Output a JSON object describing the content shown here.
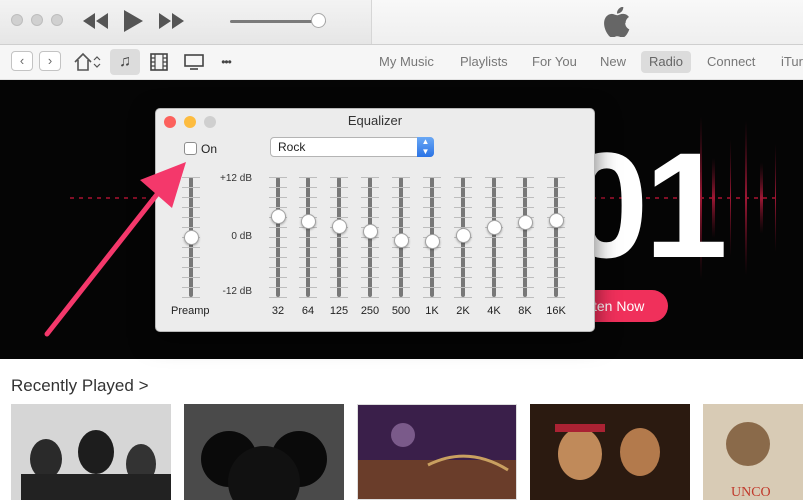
{
  "toolbar": {
    "volume": 0.92
  },
  "nav": {
    "back": "‹",
    "forward": "›",
    "more": "•••",
    "links": [
      {
        "label": "My Music",
        "selected": false
      },
      {
        "label": "Playlists",
        "selected": false
      },
      {
        "label": "For You",
        "selected": false
      },
      {
        "label": "New",
        "selected": false
      },
      {
        "label": "Radio",
        "selected": true
      },
      {
        "label": "Connect",
        "selected": false
      },
      {
        "label": "iTur",
        "selected": false
      }
    ]
  },
  "hero": {
    "big_text": "01",
    "button": "ten Now",
    "accent": "#f0305b"
  },
  "recent": {
    "title": "Recently Played >"
  },
  "equalizer": {
    "title": "Equalizer",
    "on_label": "On",
    "on_checked": false,
    "preset": "Rock",
    "db_top": "+12 dB",
    "db_mid": "0 dB",
    "db_bot": "-12 dB",
    "preamp_label": "Preamp",
    "preamp_db": 0,
    "bands": [
      {
        "freq": "32",
        "db": 4.2
      },
      {
        "freq": "64",
        "db": 3.2
      },
      {
        "freq": "125",
        "db": 2.3
      },
      {
        "freq": "250",
        "db": 1.2
      },
      {
        "freq": "500",
        "db": -0.5
      },
      {
        "freq": "1K",
        "db": -0.8
      },
      {
        "freq": "2K",
        "db": 0.5
      },
      {
        "freq": "4K",
        "db": 2.0
      },
      {
        "freq": "8K",
        "db": 3.0
      },
      {
        "freq": "16K",
        "db": 3.5
      }
    ]
  },
  "colors": {
    "close": "#fc615d",
    "minimize": "#fdbc40",
    "zoom": "#cfcfcf",
    "arrow": "#f4386b"
  }
}
